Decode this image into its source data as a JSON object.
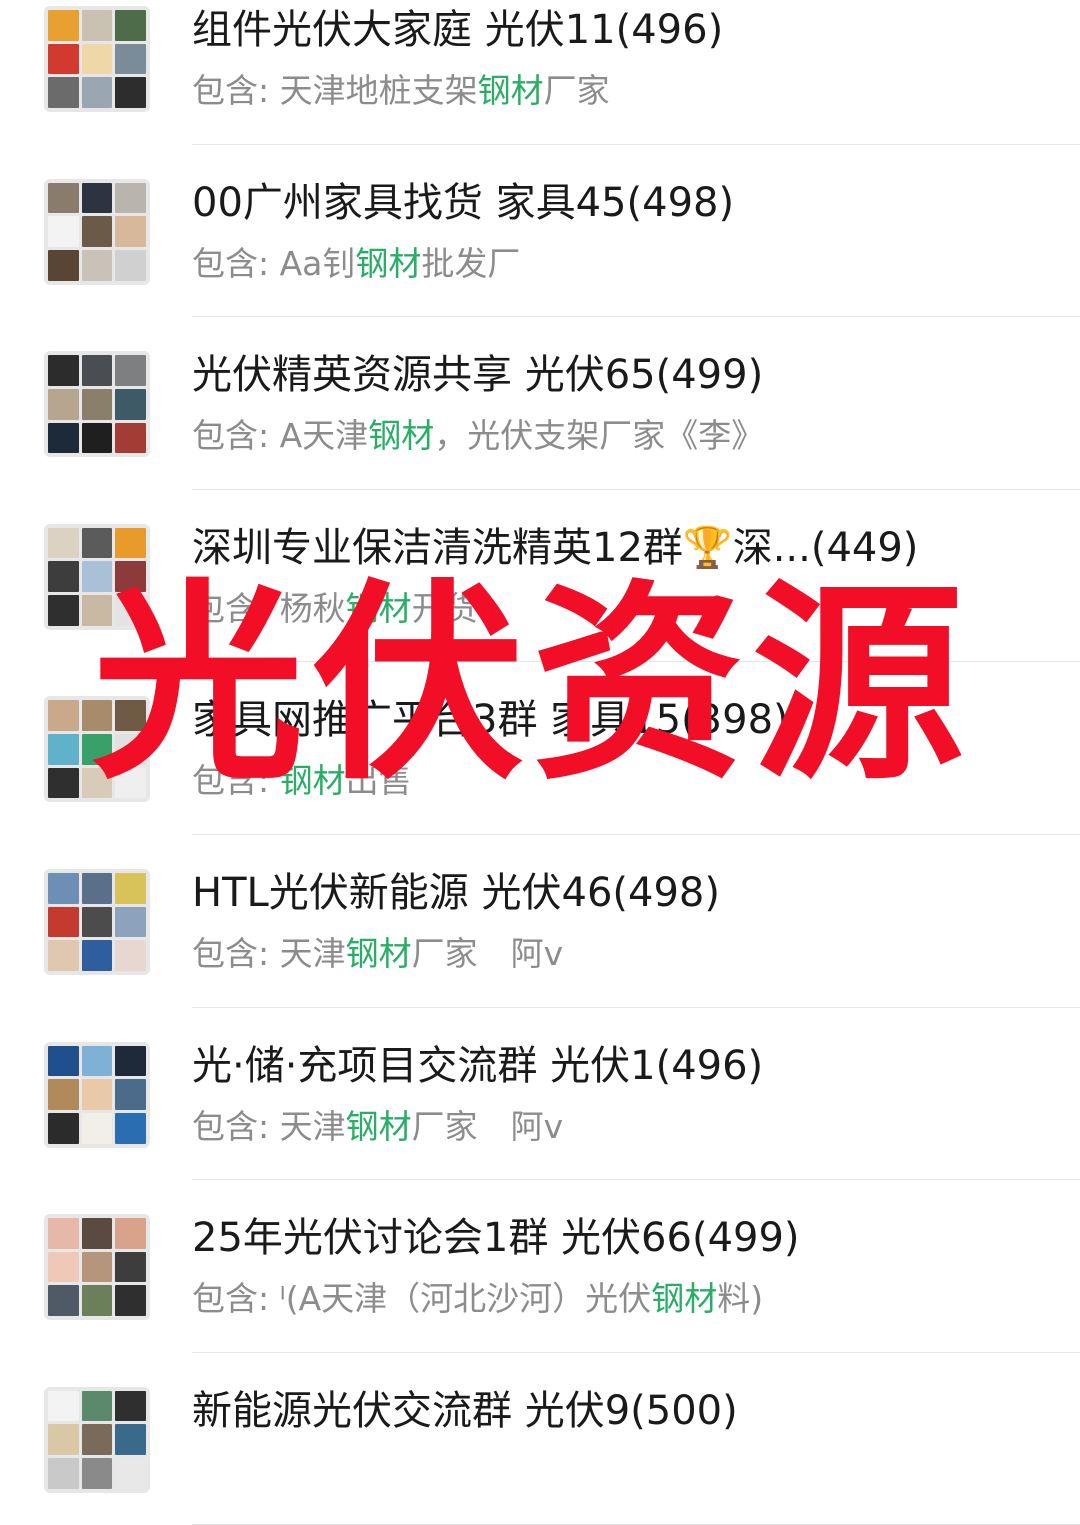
{
  "groups": [
    {
      "title": "组件光伏大家庭 光伏11(496)",
      "sub_prefix": "包含: 天津地桩支架",
      "sub_match": "钢材",
      "sub_suffix": "厂家",
      "colors": [
        "#e8a030",
        "#c9c1b1",
        "#4e6b4a",
        "#d23a2f",
        "#f0d7a8",
        "#7a8c99",
        "#6b6b6b",
        "#9aa7b3",
        "#2d2d2d"
      ]
    },
    {
      "title": "00广州家具找货 家具45(498)",
      "sub_prefix": "包含: Aa钊",
      "sub_match": "钢材",
      "sub_suffix": "批发厂",
      "colors": [
        "#8a7c6d",
        "#2b3440",
        "#b9b4ad",
        "#f3f3f3",
        "#6b5a48",
        "#d8b89a",
        "#5a4534",
        "#c8c2b8",
        "#d0d0d0"
      ]
    },
    {
      "title": "光伏精英资源共享 光伏65(499)",
      "sub_prefix": "包含: A天津",
      "sub_match": "钢材",
      "sub_suffix": "，光伏支架厂家《李》",
      "colors": [
        "#2c2c2c",
        "#4a4e52",
        "#7d7f80",
        "#b6a68f",
        "#8a7f6a",
        "#3d5a66",
        "#1d2a3a",
        "#1f1f1f",
        "#a23c35"
      ]
    },
    {
      "title": "深圳专业保洁清洗精英12群🏆深...(449)",
      "sub_prefix": "包含: 杨秋",
      "sub_match": "钢材",
      "sub_suffix": "开货",
      "colors": [
        "#dcd2c1",
        "#5b5b5b",
        "#e89a2b",
        "#3d3d3d",
        "#a9c1d6",
        "#8c3a3a",
        "#2f2f2f",
        "#c9b9a2",
        "#e3e3e3"
      ]
    },
    {
      "title": "家具网推广平台3群 家具15(398)",
      "sub_prefix": "包含: ",
      "sub_match": "钢材",
      "sub_suffix": "出售",
      "colors": [
        "#c9a98a",
        "#a88b6a",
        "#6e5a45",
        "#5fb2c9",
        "#3aa06a",
        "#e1e1e1",
        "#2f2f2f",
        "#d8cbb7",
        "#efefef"
      ]
    },
    {
      "title": "HTL光伏新能源 光伏46(498)",
      "sub_prefix": "包含: 天津",
      "sub_match": "钢材",
      "sub_suffix": "厂家　阿v",
      "colors": [
        "#6e8fb5",
        "#5a6f8a",
        "#d7c35a",
        "#c43a2f",
        "#4c4c4c",
        "#8da3bd",
        "#e0c7b0",
        "#2f5e9e",
        "#e8d7d0"
      ]
    },
    {
      "title": "光·储·充项目交流群 光伏1(496)",
      "sub_prefix": "包含: 天津",
      "sub_match": "钢材",
      "sub_suffix": "厂家　阿v",
      "colors": [
        "#1f4f8c",
        "#7fb0d6",
        "#1e2a3a",
        "#b08a5a",
        "#e8c9a8",
        "#4c6a8a",
        "#2b2b2b",
        "#f2efe8",
        "#2a6db0"
      ]
    },
    {
      "title": "25年光伏讨论会1群 光伏66(499)",
      "sub_prefix": "包含: ᴵ(A天津（河北沙河）光伏",
      "sub_match": "钢材",
      "sub_suffix": "料)",
      "colors": [
        "#e7b8a8",
        "#5a4a3f",
        "#d9a28a",
        "#f0c8b8",
        "#b5957c",
        "#3d3d3d",
        "#4f5a66",
        "#6a7f5a",
        "#2f2f2f"
      ]
    },
    {
      "title": "新能源光伏交流群 光伏9(500)",
      "sub_prefix": "",
      "sub_match": "",
      "sub_suffix": "",
      "colors": [
        "#f3f3f3",
        "#5b8a6b",
        "#2f2f2f",
        "#d9c7a5",
        "#7a6a5a",
        "#3a6a8a",
        "#c9c9c9",
        "#8a8a8a",
        "#e8e8e8"
      ]
    }
  ],
  "overlay_text": "光伏资源"
}
